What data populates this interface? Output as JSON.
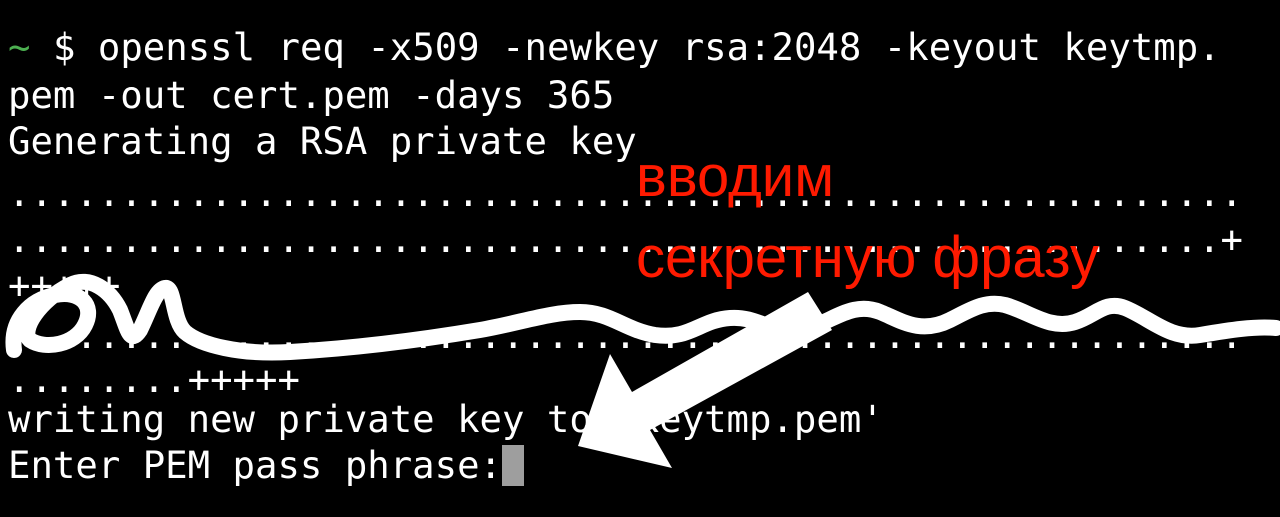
{
  "terminal": {
    "prompt_symbol": "~",
    "prompt_dollar": "$",
    "command_line_1": "openssl req -x509 -newkey rsa:2048 -keyout keytmp.",
    "command_line_2": "pem -out cert.pem -days 365",
    "output_generating": "Generating a RSA private key",
    "dots_line_1": ".......................................................",
    "dots_line_2": "......................................................+",
    "plus_line": "+++++",
    "dots_line_3": ".......................................................",
    "dots_line_4": "........+++++",
    "output_writing": "writing new private key to 'keytmp.pem'",
    "pass_prompt": "Enter PEM pass phrase:"
  },
  "annotation": {
    "line_1": "вводим",
    "line_2": "секретную фразу",
    "text_color": "#ff1a00",
    "arrow_color": "#ffffff",
    "scribble_color": "#ffffff"
  },
  "colors": {
    "background": "#000000",
    "text": "#ffffff",
    "prompt_tilde": "#4caf50",
    "cursor": "#9e9e9e"
  }
}
